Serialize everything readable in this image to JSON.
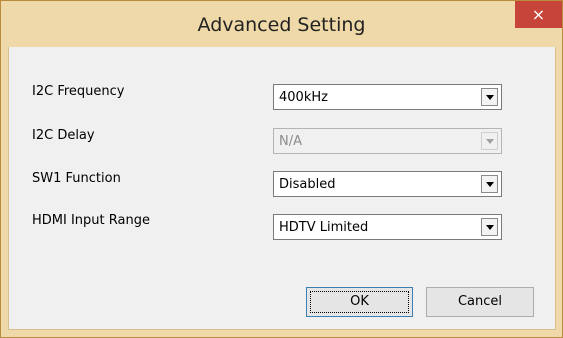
{
  "window": {
    "title": "Advanced Setting",
    "close_glyph": "×"
  },
  "settings": [
    {
      "label": "I2C Frequency",
      "value": "400kHz",
      "enabled": true
    },
    {
      "label": "I2C Delay",
      "value": "N/A",
      "enabled": false
    },
    {
      "label": "SW1 Function",
      "value": "Disabled",
      "enabled": true
    },
    {
      "label": "HDMI Input Range",
      "value": "HDTV Limited",
      "enabled": true
    }
  ],
  "buttons": {
    "ok_label": "OK",
    "cancel_label": "Cancel"
  },
  "colors": {
    "titlebar": "#efd9a8",
    "close_button": "#c7443a",
    "client_background": "#f0f0f0"
  }
}
